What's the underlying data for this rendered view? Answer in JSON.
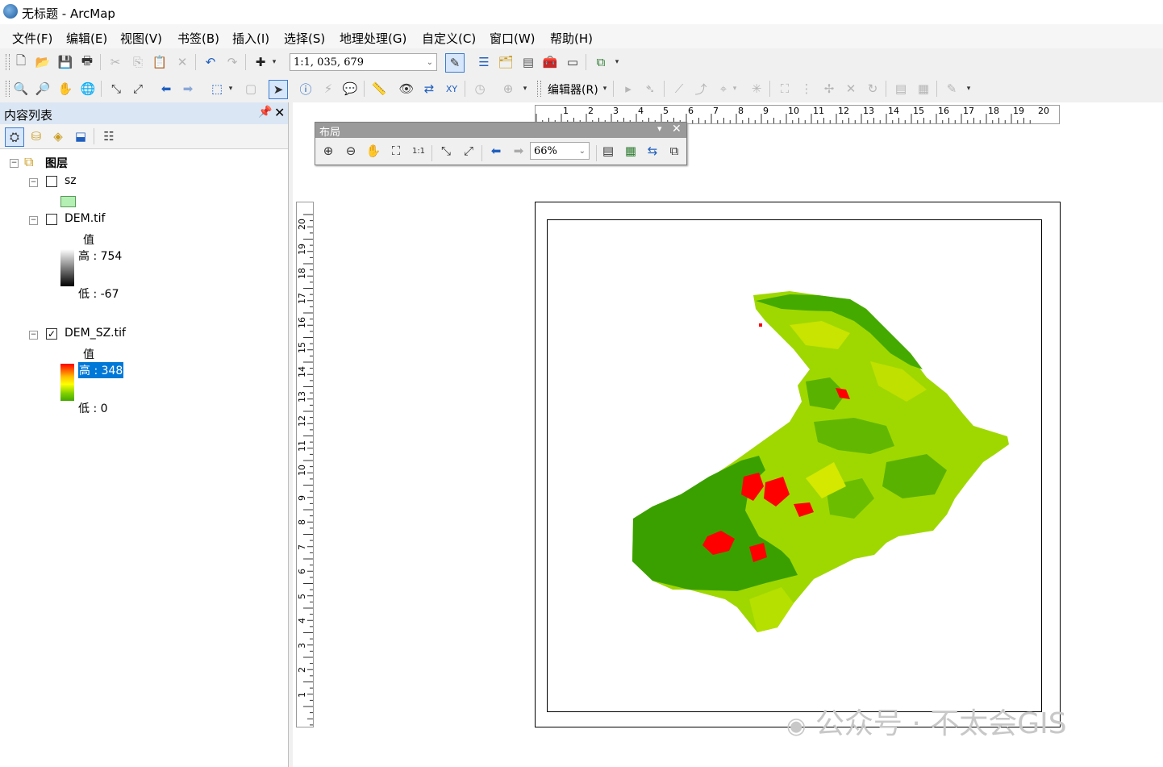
{
  "window": {
    "title": "无标题 - ArcMap"
  },
  "menu": [
    "文件(F)",
    "编辑(E)",
    "视图(V)",
    "书签(B)",
    "插入(I)",
    "选择(S)",
    "地理处理(G)",
    "自定义(C)",
    "窗口(W)",
    "帮助(H)"
  ],
  "toolbar": {
    "scale_value": "1:1, 035, 679",
    "editor_label": "编辑器(R)"
  },
  "toc": {
    "title": "内容列表",
    "root_label": "图层",
    "layers": [
      {
        "name": "sz",
        "checked": false,
        "swatch_color": "#b4f0b4"
      },
      {
        "name": "DEM.tif",
        "checked": false,
        "value_label": "值",
        "high": "高 : 754",
        "low": "低 : -67"
      },
      {
        "name": "DEM_SZ.tif",
        "checked": true,
        "value_label": "值",
        "high": "高 : 348",
        "low": "低 : 0"
      }
    ]
  },
  "layout_toolbar": {
    "title": "布局",
    "zoom_value": "66%"
  },
  "hruler_labels": [
    "1",
    "2",
    "3",
    "4",
    "5",
    "6",
    "7",
    "8",
    "9",
    "10",
    "11",
    "12",
    "13",
    "14",
    "15",
    "16",
    "17",
    "18",
    "19",
    "20"
  ],
  "vruler_labels": [
    "20",
    "19",
    "18",
    "17",
    "16",
    "15",
    "14",
    "13",
    "12",
    "11",
    "10",
    "9",
    "8",
    "7",
    "6",
    "5",
    "4",
    "3",
    "2",
    "1"
  ],
  "watermark": "公众号 · 不太会GIS",
  "colors": {
    "accent": "#0078d7",
    "toc_header": "#dbe6f4",
    "map_low": "#3aa000",
    "map_mid": "#a8e000",
    "map_high": "#ff0000"
  }
}
